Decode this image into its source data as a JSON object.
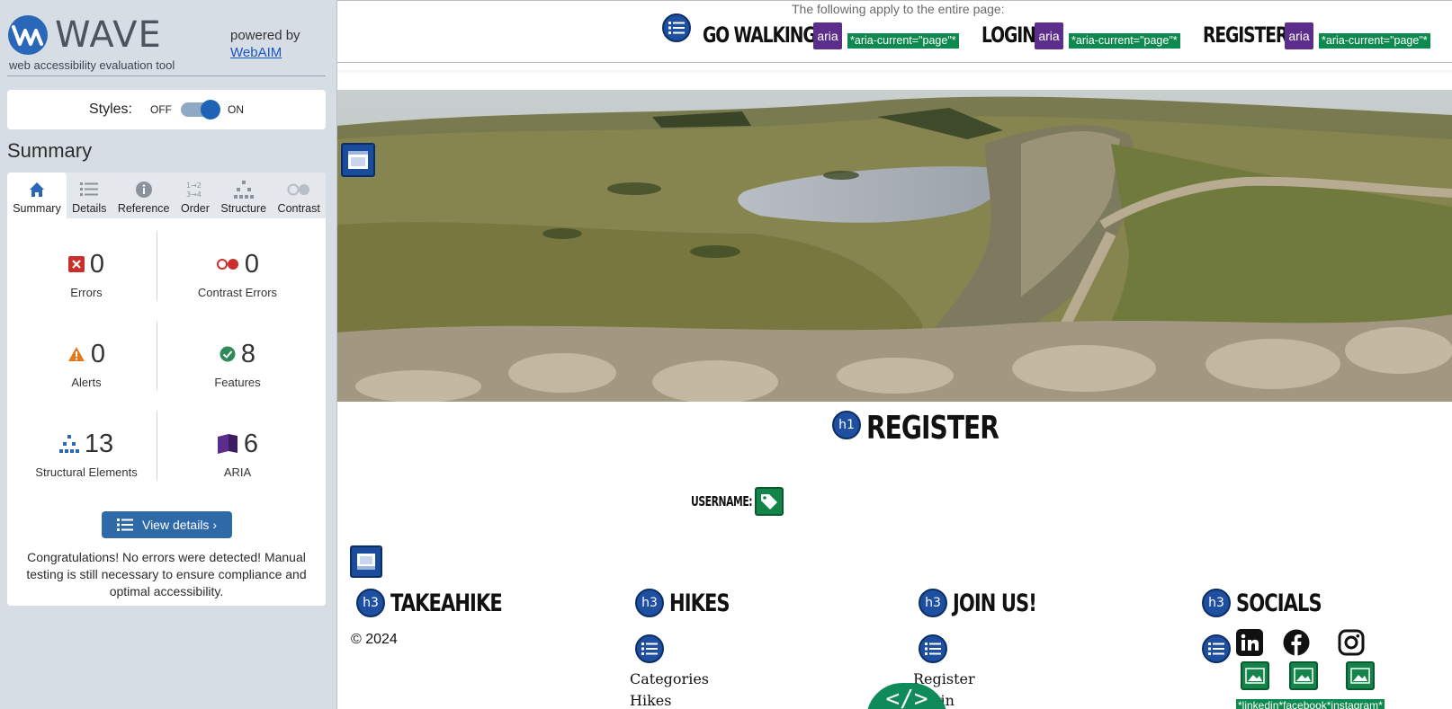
{
  "wave": {
    "brand": "WAVE",
    "subtitle": "web accessibility evaluation tool",
    "powered_by": "powered by",
    "webaim_link": "WebAIM",
    "styles_label": "Styles:",
    "styles_off": "OFF",
    "styles_on": "ON",
    "styles_state": "on",
    "summary_title": "Summary",
    "tabs": [
      {
        "label": "Summary",
        "icon": "home-icon",
        "active": true
      },
      {
        "label": "Details",
        "icon": "list-icon"
      },
      {
        "label": "Reference",
        "icon": "info-icon"
      },
      {
        "label": "Order",
        "icon": "order-icon"
      },
      {
        "label": "Structure",
        "icon": "structure-icon"
      },
      {
        "label": "Contrast",
        "icon": "contrast-icon"
      }
    ],
    "stats": {
      "errors": {
        "value": "0",
        "label": "Errors"
      },
      "contrast_errors": {
        "value": "0",
        "label": "Contrast Errors"
      },
      "alerts": {
        "value": "0",
        "label": "Alerts"
      },
      "features": {
        "value": "8",
        "label": "Features"
      },
      "structural": {
        "value": "13",
        "label": "Structural Elements"
      },
      "aria": {
        "value": "6",
        "label": "ARIA"
      }
    },
    "view_details": "View details ›",
    "congrats": "Congratulations! No errors were detected! Manual testing is still necessary to ensure compliance and optimal accessibility."
  },
  "page": {
    "note": "The following apply to the entire page:",
    "nav": [
      {
        "label": "GO WALKING!",
        "aria_tag": "*aria-current=\"page\"*"
      },
      {
        "label": "LOGIN",
        "aria_tag": "*aria-current=\"page\"*"
      },
      {
        "label": "REGISTER",
        "aria_tag": "*aria-current=\"page\"*"
      }
    ],
    "aria_badge": "aria",
    "h1_badge": "h1",
    "h3_badge": "h3",
    "title": "REGISTER",
    "username_label": "USERNAME:",
    "footer": {
      "col1_title": "TAKEAHIKE",
      "copyright": "© 2024",
      "col2_title": "HIKES",
      "col2_links": [
        "Categories",
        "Hikes"
      ],
      "col3_title": "JOIN US!",
      "col3_links": [
        "Register",
        "Login"
      ],
      "col4_title": "SOCIALS",
      "social_tags": "*linkedin*facebook*instagram*"
    },
    "code_button": "</>"
  },
  "colors": {
    "wave_blue": "#1f63b7",
    "aria_purple": "#5a2e8a",
    "feature_green": "#14844a",
    "error_red": "#c9302c",
    "alert_orange": "#e27a1f"
  }
}
